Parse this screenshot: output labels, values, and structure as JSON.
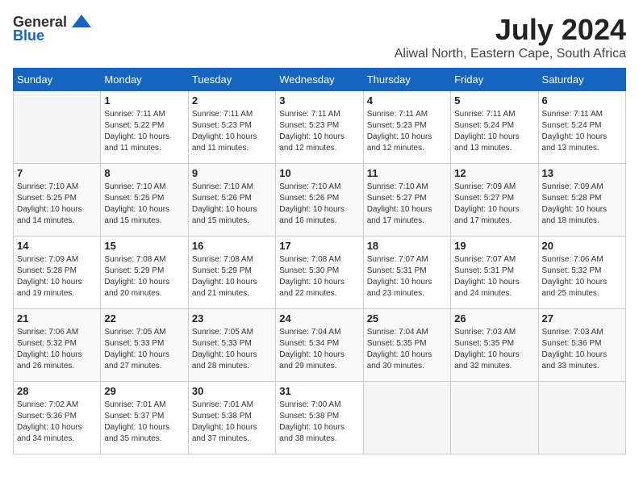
{
  "logo": {
    "general": "General",
    "blue": "Blue"
  },
  "title": {
    "month": "July 2024",
    "location": "Aliwal North, Eastern Cape, South Africa"
  },
  "days_of_week": [
    "Sunday",
    "Monday",
    "Tuesday",
    "Wednesday",
    "Thursday",
    "Friday",
    "Saturday"
  ],
  "weeks": [
    [
      {
        "day": "",
        "info": ""
      },
      {
        "day": "1",
        "info": "Sunrise: 7:11 AM\nSunset: 5:22 PM\nDaylight: 10 hours\nand 11 minutes."
      },
      {
        "day": "2",
        "info": "Sunrise: 7:11 AM\nSunset: 5:23 PM\nDaylight: 10 hours\nand 11 minutes."
      },
      {
        "day": "3",
        "info": "Sunrise: 7:11 AM\nSunset: 5:23 PM\nDaylight: 10 hours\nand 12 minutes."
      },
      {
        "day": "4",
        "info": "Sunrise: 7:11 AM\nSunset: 5:23 PM\nDaylight: 10 hours\nand 12 minutes."
      },
      {
        "day": "5",
        "info": "Sunrise: 7:11 AM\nSunset: 5:24 PM\nDaylight: 10 hours\nand 13 minutes."
      },
      {
        "day": "6",
        "info": "Sunrise: 7:11 AM\nSunset: 5:24 PM\nDaylight: 10 hours\nand 13 minutes."
      }
    ],
    [
      {
        "day": "7",
        "info": "Sunrise: 7:10 AM\nSunset: 5:25 PM\nDaylight: 10 hours\nand 14 minutes."
      },
      {
        "day": "8",
        "info": "Sunrise: 7:10 AM\nSunset: 5:25 PM\nDaylight: 10 hours\nand 15 minutes."
      },
      {
        "day": "9",
        "info": "Sunrise: 7:10 AM\nSunset: 5:26 PM\nDaylight: 10 hours\nand 15 minutes."
      },
      {
        "day": "10",
        "info": "Sunrise: 7:10 AM\nSunset: 5:26 PM\nDaylight: 10 hours\nand 16 minutes."
      },
      {
        "day": "11",
        "info": "Sunrise: 7:10 AM\nSunset: 5:27 PM\nDaylight: 10 hours\nand 17 minutes."
      },
      {
        "day": "12",
        "info": "Sunrise: 7:09 AM\nSunset: 5:27 PM\nDaylight: 10 hours\nand 17 minutes."
      },
      {
        "day": "13",
        "info": "Sunrise: 7:09 AM\nSunset: 5:28 PM\nDaylight: 10 hours\nand 18 minutes."
      }
    ],
    [
      {
        "day": "14",
        "info": "Sunrise: 7:09 AM\nSunset: 5:28 PM\nDaylight: 10 hours\nand 19 minutes."
      },
      {
        "day": "15",
        "info": "Sunrise: 7:08 AM\nSunset: 5:29 PM\nDaylight: 10 hours\nand 20 minutes."
      },
      {
        "day": "16",
        "info": "Sunrise: 7:08 AM\nSunset: 5:29 PM\nDaylight: 10 hours\nand 21 minutes."
      },
      {
        "day": "17",
        "info": "Sunrise: 7:08 AM\nSunset: 5:30 PM\nDaylight: 10 hours\nand 22 minutes."
      },
      {
        "day": "18",
        "info": "Sunrise: 7:07 AM\nSunset: 5:31 PM\nDaylight: 10 hours\nand 23 minutes."
      },
      {
        "day": "19",
        "info": "Sunrise: 7:07 AM\nSunset: 5:31 PM\nDaylight: 10 hours\nand 24 minutes."
      },
      {
        "day": "20",
        "info": "Sunrise: 7:06 AM\nSunset: 5:32 PM\nDaylight: 10 hours\nand 25 minutes."
      }
    ],
    [
      {
        "day": "21",
        "info": "Sunrise: 7:06 AM\nSunset: 5:32 PM\nDaylight: 10 hours\nand 26 minutes."
      },
      {
        "day": "22",
        "info": "Sunrise: 7:05 AM\nSunset: 5:33 PM\nDaylight: 10 hours\nand 27 minutes."
      },
      {
        "day": "23",
        "info": "Sunrise: 7:05 AM\nSunset: 5:33 PM\nDaylight: 10 hours\nand 28 minutes."
      },
      {
        "day": "24",
        "info": "Sunrise: 7:04 AM\nSunset: 5:34 PM\nDaylight: 10 hours\nand 29 minutes."
      },
      {
        "day": "25",
        "info": "Sunrise: 7:04 AM\nSunset: 5:35 PM\nDaylight: 10 hours\nand 30 minutes."
      },
      {
        "day": "26",
        "info": "Sunrise: 7:03 AM\nSunset: 5:35 PM\nDaylight: 10 hours\nand 32 minutes."
      },
      {
        "day": "27",
        "info": "Sunrise: 7:03 AM\nSunset: 5:36 PM\nDaylight: 10 hours\nand 33 minutes."
      }
    ],
    [
      {
        "day": "28",
        "info": "Sunrise: 7:02 AM\nSunset: 5:36 PM\nDaylight: 10 hours\nand 34 minutes."
      },
      {
        "day": "29",
        "info": "Sunrise: 7:01 AM\nSunset: 5:37 PM\nDaylight: 10 hours\nand 35 minutes."
      },
      {
        "day": "30",
        "info": "Sunrise: 7:01 AM\nSunset: 5:38 PM\nDaylight: 10 hours\nand 37 minutes."
      },
      {
        "day": "31",
        "info": "Sunrise: 7:00 AM\nSunset: 5:38 PM\nDaylight: 10 hours\nand 38 minutes."
      },
      {
        "day": "",
        "info": ""
      },
      {
        "day": "",
        "info": ""
      },
      {
        "day": "",
        "info": ""
      }
    ]
  ]
}
